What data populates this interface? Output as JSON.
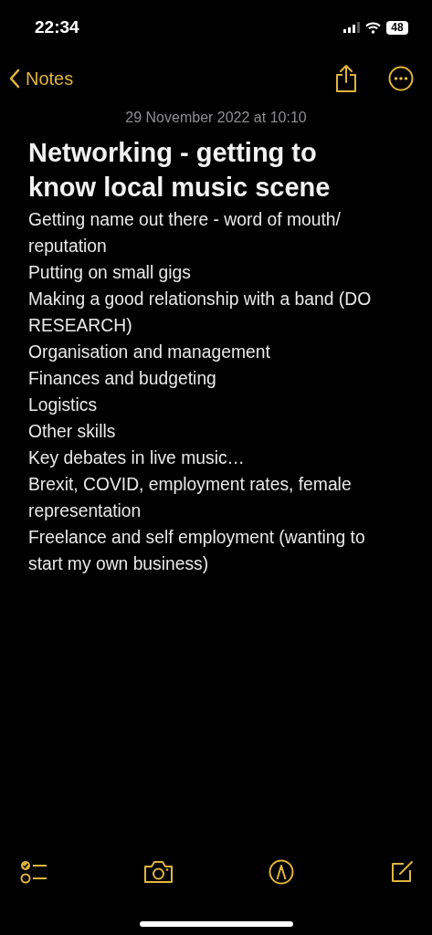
{
  "status_bar": {
    "time": "22:34",
    "battery": "48"
  },
  "nav": {
    "back_label": "Notes"
  },
  "note": {
    "date": "29 November 2022 at 10:10",
    "title": "Networking - getting to know local music scene",
    "lines": [
      "Getting name out there - word of mouth/ reputation",
      "Putting on small gigs",
      "Making a good relationship with a band (DO RESEARCH)",
      "Organisation and management",
      "Finances and budgeting",
      "Logistics",
      "Other skills",
      "Key debates in live music…",
      "Brexit, COVID, employment rates, female representation",
      "Freelance and self employment (wanting to start my own business)"
    ]
  }
}
